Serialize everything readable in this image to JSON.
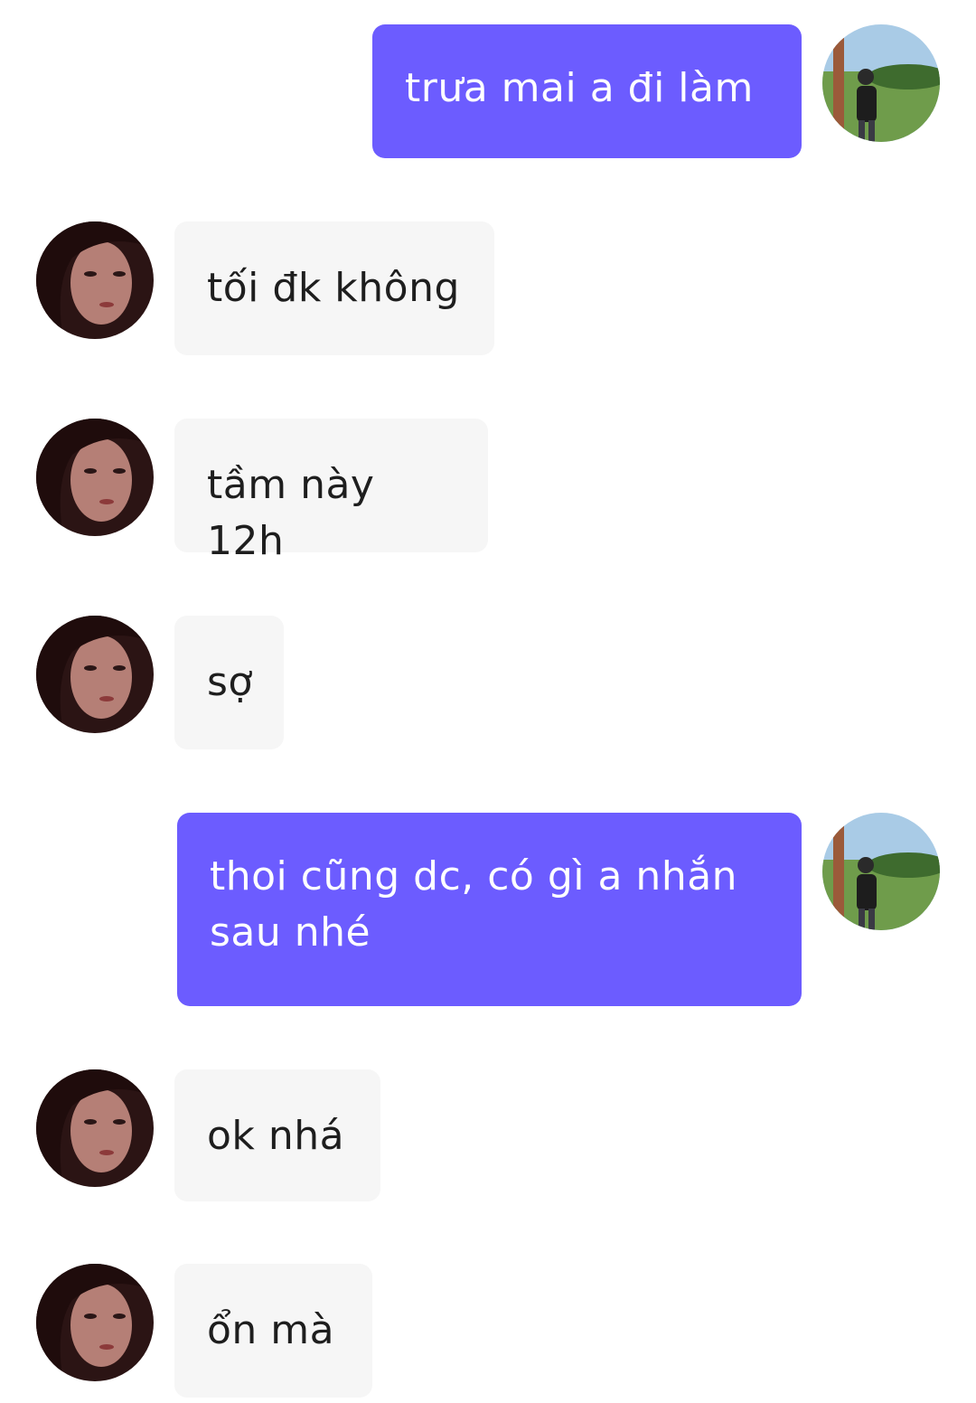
{
  "messages": [
    {
      "from": "me",
      "text": "trưa mai a đi làm"
    },
    {
      "from": "them",
      "text": "tối đk không"
    },
    {
      "from": "them",
      "text": "tầm này 12h"
    },
    {
      "from": "them",
      "text": "sợ"
    },
    {
      "from": "me",
      "text": "thoi cũng dc, có gì a nhắn sau nhé"
    },
    {
      "from": "them",
      "text": "ok nhá"
    },
    {
      "from": "them",
      "text": "ổn mà"
    }
  ],
  "colors": {
    "sent_bubble": "#6c5cff",
    "received_bubble": "#f6f6f6"
  },
  "icons": {
    "me_avatar": "man-in-field-photo-avatar",
    "them_avatar": "woman-portrait-photo-avatar"
  }
}
